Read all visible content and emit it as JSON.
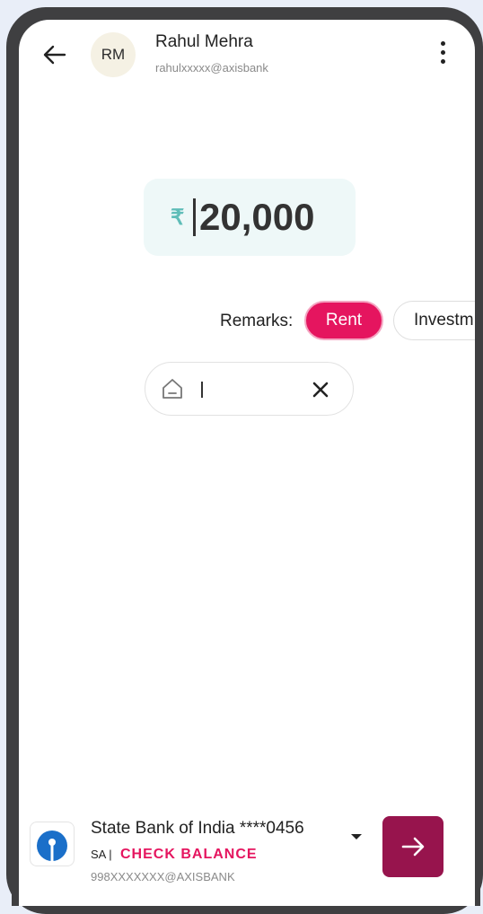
{
  "header": {
    "avatar_initials": "RM",
    "name": "Rahul Mehra",
    "upi_id": "rahulxxxxx@axisbank"
  },
  "amount": {
    "currency_symbol": "₹",
    "value": "20,000"
  },
  "remarks": {
    "label": "Remarks:",
    "chips": [
      "Rent",
      "Investm"
    ],
    "selected": "Rent",
    "input_value": ""
  },
  "payment_source": {
    "bank_name": "State Bank of India ****0456",
    "account_type": "SA |",
    "check_balance_label": "CHECK BALANCE",
    "upi_id": "998XXXXXXX@AXISBANK"
  },
  "colors": {
    "accent_pink": "#e5155f",
    "brand_maroon": "#97144d",
    "amount_bg": "#eef8f8",
    "rupee": "#5fbdb8"
  },
  "icons": [
    "back-arrow-icon",
    "more-vert-icon",
    "home-icon",
    "close-icon",
    "sbi-logo-icon",
    "caret-down-icon",
    "arrow-right-icon"
  ]
}
